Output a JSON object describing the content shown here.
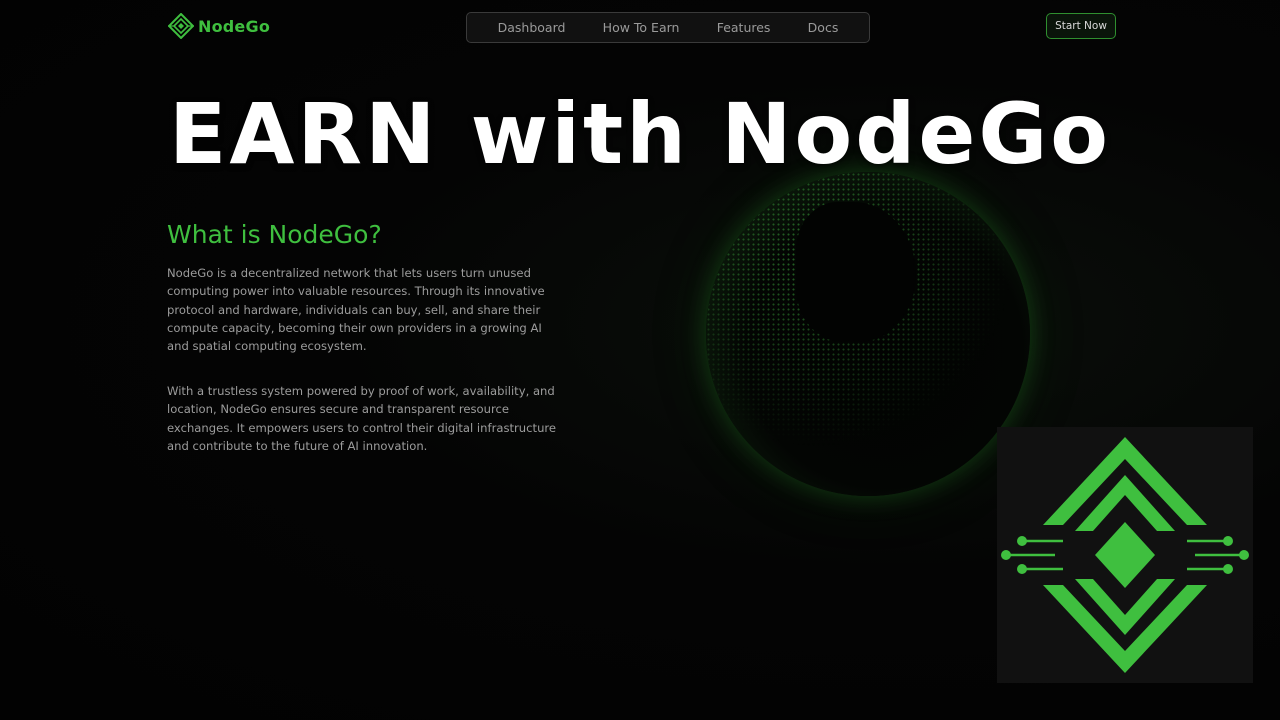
{
  "header": {
    "brand": "NodeGo",
    "logo_icon": "nodego-diamond-icon",
    "nav": [
      {
        "label": "Dashboard"
      },
      {
        "label": "How To Earn"
      },
      {
        "label": "Features"
      },
      {
        "label": "Docs"
      }
    ],
    "cta_label": "Start Now"
  },
  "overlay": {
    "title": "EARN with NodeGo"
  },
  "main": {
    "heading": "What is NodeGo?",
    "paragraphs": [
      "NodeGo is a decentralized network that lets users turn unused computing power into valuable resources. Through its innovative protocol and hardware, individuals can buy, sell, and share their compute capacity, becoming their own providers in a growing AI and spatial computing ecosystem.",
      "With a trustless system powered by proof of work, availability, and location, NodeGo ensures secure and transparent resource exchanges. It empowers users to control their digital infrastructure and contribute to the future of AI innovation."
    ]
  },
  "colors": {
    "accent": "#3fbf3f",
    "logo_green": "#3fbf3f",
    "background": "#030303"
  }
}
